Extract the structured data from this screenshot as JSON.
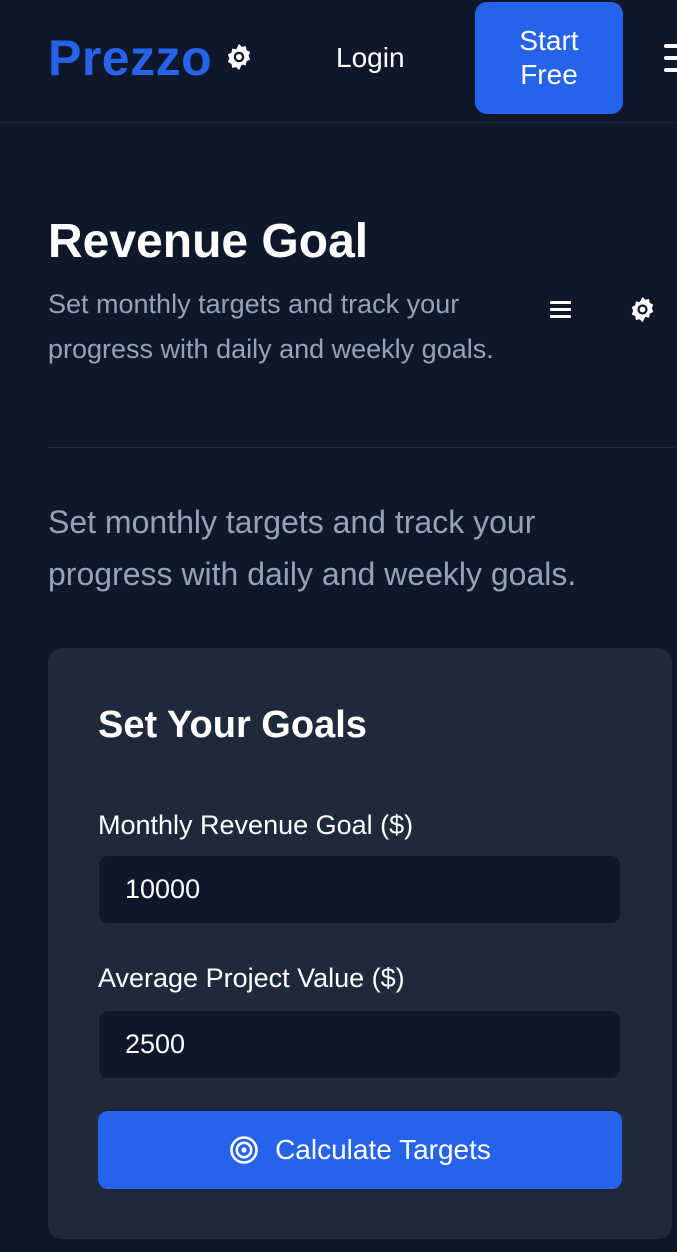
{
  "header": {
    "logo": "Prezzo",
    "login_label": "Login",
    "start_label": "Start Free"
  },
  "page": {
    "title": "Revenue Goal",
    "subtitle": "Set monthly targets and track your progress with daily and weekly goals.",
    "lead": "Set monthly targets and track your progress with daily and weekly goals."
  },
  "form": {
    "title": "Set Your Goals",
    "monthly_label": "Monthly Revenue Goal ($)",
    "monthly_value": "10000",
    "project_label": "Average Project Value ($)",
    "project_value": "2500",
    "calculate_label": "Calculate Targets"
  },
  "colors": {
    "background": "#0f172a",
    "card": "#1e293b",
    "accent": "#2563eb",
    "muted_text": "#94a3b8"
  },
  "icons": {
    "header_settings": "gear-icon",
    "header_menu": "hamburger-menu-icon",
    "title_menu": "hamburger-menu-icon",
    "title_settings": "gear-icon",
    "calculate": "target-icon"
  }
}
